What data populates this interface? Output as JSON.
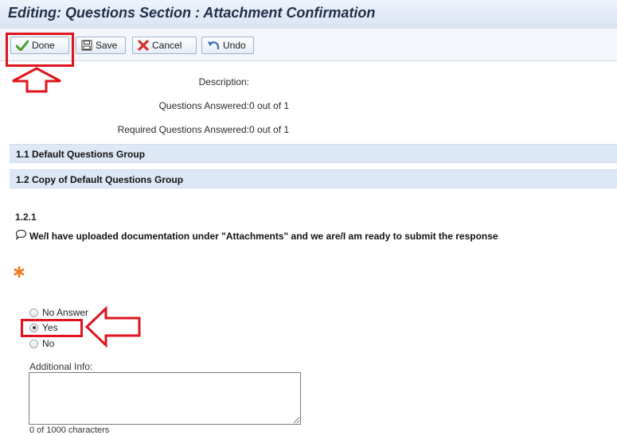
{
  "header": {
    "title": "Editing: Questions Section : Attachment Confirmation"
  },
  "toolbar": {
    "done_label": "Done",
    "save_label": "Save",
    "cancel_label": "Cancel",
    "undo_label": "Undo"
  },
  "summary": {
    "description_label": "Description:",
    "description_value": "",
    "answered_label": "Questions Answered:",
    "answered_value": "0 out of 1",
    "required_label": "Required Questions Answered:",
    "required_value": "0 out of 1"
  },
  "groups": [
    {
      "label": "1.1 Default Questions Group"
    },
    {
      "label": "1.2 Copy of Default Questions Group"
    }
  ],
  "question": {
    "number": "1.2.1",
    "text": "We/I have uploaded documentation under \"Attachments\" and we are/I am ready to submit the response",
    "options": [
      {
        "label": "No Answer",
        "selected": false
      },
      {
        "label": "Yes",
        "selected": true
      },
      {
        "label": "No",
        "selected": false
      }
    ],
    "additional_info_label": "Additional Info:",
    "additional_info_value": "",
    "char_count": "0 of 1000 characters"
  },
  "colors": {
    "highlight": "#e0141e",
    "band": "#dde8f6",
    "required_star": "#f07818",
    "done_check": "#4aa02c",
    "cancel_x": "#d32f2f"
  }
}
